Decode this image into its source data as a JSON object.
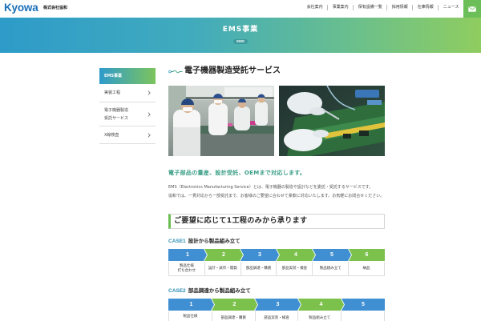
{
  "header": {
    "logo": "Kyowa",
    "company": "株式会社協和",
    "nav": [
      "会社案内",
      "事業案内",
      "保有設備一覧",
      "採用情報",
      "在庫情報",
      "ニュース"
    ]
  },
  "banner": {
    "title": "EMS事業",
    "tag": "EMS"
  },
  "sidebar": {
    "items": [
      {
        "lines": [
          "EMS事業"
        ],
        "active": true
      },
      {
        "lines": [
          "実装工程"
        ],
        "active": false
      },
      {
        "lines": [
          "電子機器製造",
          "受託サービス"
        ],
        "active": false
      },
      {
        "lines": [
          "X線検査"
        ],
        "active": false
      }
    ]
  },
  "main": {
    "title": "電子機器製造受託サービス",
    "lead": "電子部品の量産、設計受託、OEMまで対応します。",
    "description": [
      "EMS（Electronics Manufacturing Service）とは、電子機器の製造や設計などを委託・受託するサービスです。",
      "協和では、一貫対応から一部受託まで、お客様のご要望に合わせて柔軟に対応いたします。お気軽にお問合せください。"
    ],
    "section_heading": "ご要望に応じて1工程のみから承ります",
    "cases": [
      {
        "label": "CASE1",
        "title": "設計から製品組み立て",
        "steps": [
          {
            "num": "1",
            "color": "#3f8fd2",
            "label": [
              "製品仕様",
              "打ち合わせ"
            ]
          },
          {
            "num": "2",
            "color": "#7cc14c",
            "label": [
              "設計・試作・開発"
            ]
          },
          {
            "num": "3",
            "color": "#3f8fd2",
            "label": [
              "部品調達・購買"
            ]
          },
          {
            "num": "4",
            "color": "#7cc14c",
            "label": [
              "部品実装・検査"
            ]
          },
          {
            "num": "5",
            "color": "#3f8fd2",
            "label": [
              "製品組み立て"
            ]
          },
          {
            "num": "6",
            "color": "#7cc14c",
            "label": [
              "納品"
            ]
          }
        ]
      },
      {
        "label": "CASE2",
        "title": "部品調達から製品組み立て",
        "steps": [
          {
            "num": "1",
            "color": "#3f8fd2",
            "label": [
              "製品仕様"
            ]
          },
          {
            "num": "2",
            "color": "#7cc14c",
            "label": [
              "部品調達・購買"
            ]
          },
          {
            "num": "3",
            "color": "#3f8fd2",
            "label": [
              "部品実装・検査"
            ]
          },
          {
            "num": "4",
            "color": "#7cc14c",
            "label": [
              "製品組み立て"
            ]
          },
          {
            "num": "5",
            "color": "#3f8fd2",
            "label": []
          }
        ]
      }
    ]
  },
  "colors": {
    "logo": "#1a6fb6",
    "banner_start": "#2e9bc9",
    "banner_end": "#8fcd5f",
    "mail_button": "#6cbf58",
    "accent_green": "#6dbd55",
    "lead_text": "#3a9f86",
    "case_label": "#2c8fb5"
  },
  "icons": {
    "contact": "mail-icon",
    "sidebar_arrow": "chevron-right-icon",
    "title_mark": "wave-line-icon"
  }
}
